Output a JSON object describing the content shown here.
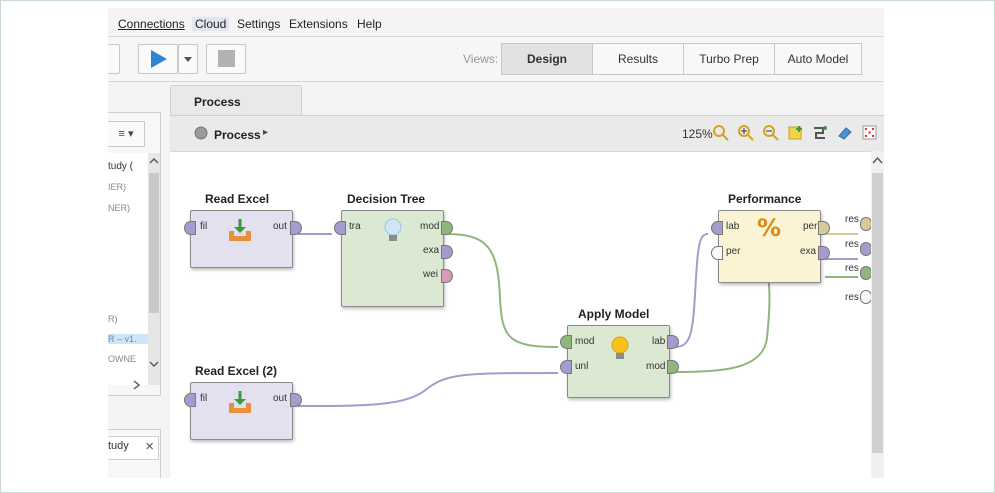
{
  "menu": {
    "connections": "Connections",
    "cloud": "Cloud",
    "settings": "Settings",
    "extensions": "Extensions",
    "help": "Help"
  },
  "toolbar": {
    "views_label": "Views:",
    "views": [
      "Design",
      "Results",
      "Turbo Prep",
      "Auto Model"
    ],
    "active_view": "Design"
  },
  "left_panel": {
    "items": [
      "tudy (",
      "IER)",
      "NER)",
      "R)",
      "R – v1.",
      "OWNE"
    ],
    "menu_icon": "≡ ▾",
    "close": "×"
  },
  "process_tab": {
    "label": "Process"
  },
  "breadcrumb": {
    "label": "Process",
    "arrow": "▸"
  },
  "zoom": "125%",
  "operators": {
    "read_excel": {
      "title": "Read Excel",
      "in": "fil",
      "out": "out"
    },
    "decision_tree": {
      "title": "Decision Tree",
      "in": "tra",
      "out1": "mod",
      "out2": "exa",
      "out3": "wei"
    },
    "apply_model": {
      "title": "Apply Model",
      "in1": "mod",
      "in2": "unl",
      "out1": "lab",
      "out2": "mod"
    },
    "performance": {
      "title": "Performance",
      "in1": "lab",
      "in2": "per",
      "out1": "per",
      "out2": "exa"
    },
    "read_excel_2": {
      "title": "Read Excel (2)",
      "in": "fil",
      "out": "out"
    }
  },
  "result_ports": [
    "res",
    "res",
    "res",
    "res"
  ]
}
